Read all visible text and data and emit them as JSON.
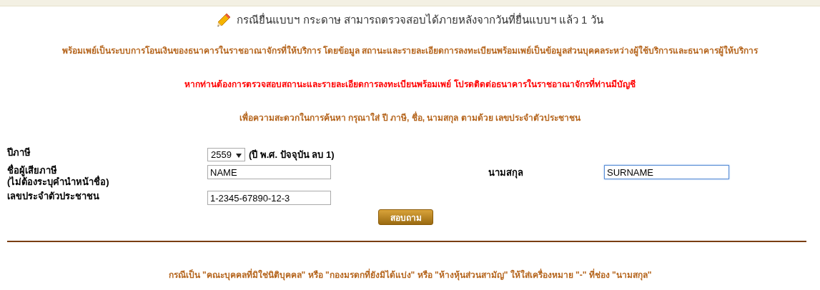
{
  "notice": {
    "text": "กรณียื่นแบบฯ กระดาษ สามารถตรวจสอบได้ภายหลังจากวันที่ยื่นแบบฯ แล้ว 1 วัน"
  },
  "messages": [
    {
      "text": "พร้อมเพย์เป็นระบบการโอนเงินของธนาคารในราชอาณาจักรที่ให้บริการ โดยข้อมูล สถานะและรายละเอียดการลงทะเบียนพร้อมเพย์เป็นข้อมูลส่วนบุคคลระหว่างผู้ใช้บริการและธนาคารผู้ให้บริการ",
      "color": "#b5651d"
    },
    {
      "text": "หากท่านต้องการตรวจสอบสถานะและรายละเอียดการลงทะเบียนพร้อมเพย์ โปรดติดต่อธนาคารในราชอาณาจักรที่ท่านมีบัญชี",
      "color": "#ff0000"
    },
    {
      "text": "เพื่อความสะดวกในการค้นหา กรุณาใส่ ปี ภาษี, ชื่อ, นามสกุล ตามด้วย เลขประจำตัวประชาชน",
      "color": "#b5651d"
    }
  ],
  "form": {
    "tax_year": {
      "label": "ปีภาษี",
      "value": "2559",
      "hint": "(ปี พ.ศ. ปัจจุบัน ลบ 1)"
    },
    "name": {
      "label": "ชื่อผู้เสียภาษี",
      "sublabel": "(ไม่ต้องระบุคำนำหน้าชื่อ)",
      "value": "NAME",
      "focused": false
    },
    "surname": {
      "label": "นามสกุล",
      "value": "SURNAME",
      "focused": true
    },
    "id_number": {
      "label": "เลขประจำตัวประชาชน",
      "value": "1-2345-67890-12-3",
      "focused": false
    },
    "submit": "สอบถาม"
  },
  "footnote": "กรณีเป็น \"คณะบุคคลที่มิใช่นิติบุคคล\" หรือ \"กองมรดกที่ยังมิได้แบ่ง\" หรือ \"ห้างหุ้นส่วนสามัญ\" ให้ใส่เครื่องหมาย \"-\" ที่ช่อง \"นามสกุล\""
}
